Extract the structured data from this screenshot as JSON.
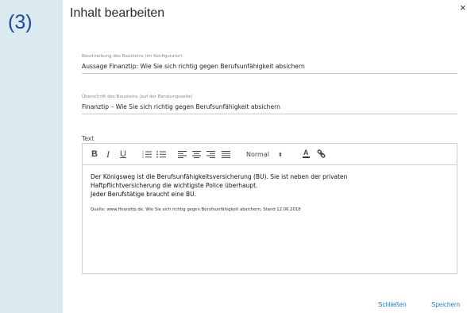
{
  "side": {
    "step_number": "(3)"
  },
  "dialog": {
    "title": "Inhalt bearbeiten",
    "close_symbol": "×"
  },
  "fields": [
    {
      "label": "Beschreibung des Bausteins (im Konfigurator)",
      "value": "Aussage Finanztip: Wie Sie sich richtig gegen Berufsunfähigkeit absichern"
    },
    {
      "label": "Überschrift des Bausteins (auf der Beratungsseite)",
      "value": "Finanztip – Wie Sie sich richtig gegen Berufsunfähigkeit absichern"
    }
  ],
  "editor": {
    "label": "Text",
    "toolbar": {
      "bold": "B",
      "italic": "I",
      "underline": "U",
      "font_size": "Normal",
      "dropdown_caret": "⬍",
      "text_color": "A",
      "icons": [
        "bold-icon",
        "italic-icon",
        "underline-icon",
        "ordered-list-icon",
        "bullet-list-icon",
        "align-left-icon",
        "align-center-icon",
        "align-right-icon",
        "align-justify-icon",
        "text-color-icon",
        "link-icon"
      ]
    },
    "body_lines": [
      "Der Königsweg ist die Berufsunfähigkeitsversicherung (BU). Sie ist neben der privaten",
      "Haftpflichtversicherung die wichtigste Police überhaupt.",
      "Jeder Berufstätige braucht eine BU."
    ],
    "source": "Quelle: www.finanztip.de, Wie Sie sich richtig gegen Berufsunfähigkeit absichern, Stand 12.06.2018"
  },
  "actions": {
    "close_label": "Schließen",
    "save_label": "Speichern"
  },
  "colors": {
    "side_panel": "#dbeaf0",
    "step_number": "#1d4c96",
    "action_link": "#2b7fc0"
  }
}
